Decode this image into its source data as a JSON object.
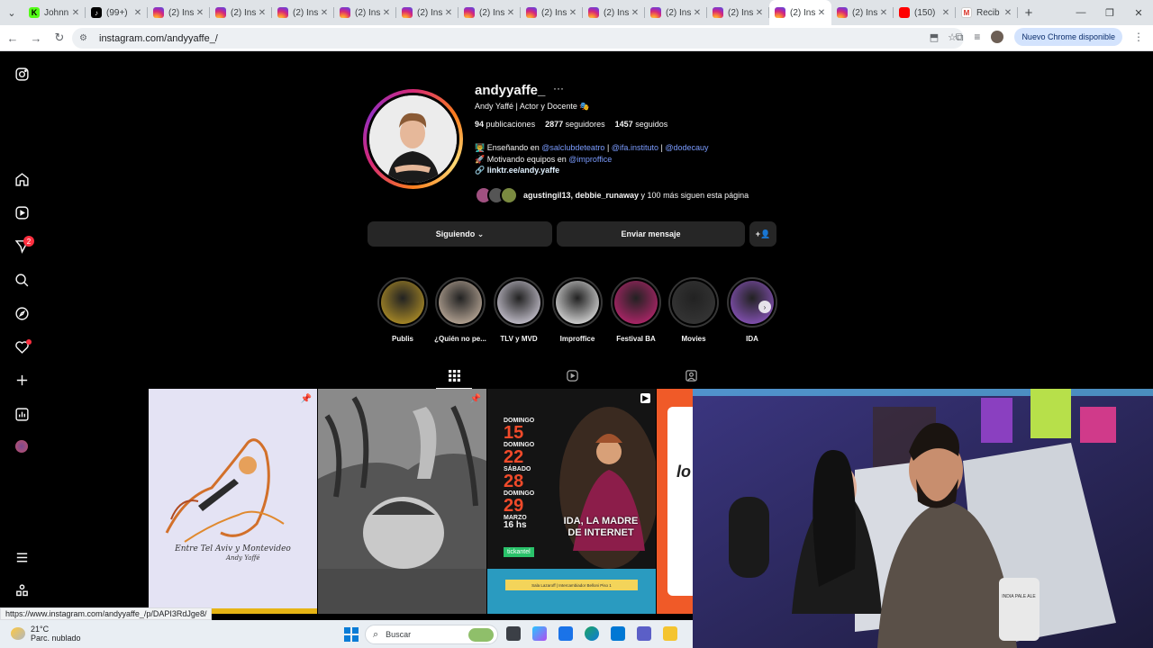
{
  "browser": {
    "tabs": [
      {
        "label": "Johnn",
        "favicon": "kick-icon",
        "active": false
      },
      {
        "label": "(99+)",
        "favicon": "tiktok-icon",
        "active": false
      },
      {
        "label": "(2) Ins",
        "favicon": "instagram-icon",
        "active": false
      },
      {
        "label": "(2) Ins",
        "favicon": "instagram-icon",
        "active": false
      },
      {
        "label": "(2) Ins",
        "favicon": "instagram-icon",
        "active": false
      },
      {
        "label": "(2) Ins",
        "favicon": "instagram-icon",
        "active": false
      },
      {
        "label": "(2) Ins",
        "favicon": "instagram-icon",
        "active": false
      },
      {
        "label": "(2) Ins",
        "favicon": "instagram-icon",
        "active": false
      },
      {
        "label": "(2) Ins",
        "favicon": "instagram-icon",
        "active": false
      },
      {
        "label": "(2) Ins",
        "favicon": "instagram-icon",
        "active": false
      },
      {
        "label": "(2) Ins",
        "favicon": "instagram-icon",
        "active": false
      },
      {
        "label": "(2) Ins",
        "favicon": "instagram-icon",
        "active": false
      },
      {
        "label": "(2) Ins",
        "favicon": "instagram-icon",
        "active": true
      },
      {
        "label": "(2) Ins",
        "favicon": "instagram-icon",
        "active": false
      },
      {
        "label": "(150)",
        "favicon": "youtube-icon",
        "active": false
      },
      {
        "label": "Recib",
        "favicon": "gmail-icon",
        "active": false
      }
    ],
    "url": "instagram.com/andyyaffe_/",
    "update_label": "Nuevo Chrome disponible",
    "status_url": "https://www.instagram.com/andyyaffe_/p/DAPI3RdJge8/"
  },
  "sidebar": {
    "notifications_badge": "2"
  },
  "profile": {
    "username": "andyyaffe_",
    "more": "···",
    "full_name": "Andy Yaffé | Actor y Docente 🎭",
    "stats": {
      "posts_count": "94",
      "posts_label": "publicaciones",
      "followers_count": "2877",
      "followers_label": "seguidores",
      "following_count": "1457",
      "following_label": "seguidos"
    },
    "bio": {
      "line1_prefix": "👨‍🏫 Enseñando en ",
      "line1_link1": "@salclubdeteatro",
      "line1_sep1": " | ",
      "line1_link2": "@ifa.instituto",
      "line1_sep2": " | ",
      "line1_link3": "@dodecauy",
      "line2_prefix": "🚀 Motivando equipos en ",
      "line2_link": "@improffice",
      "line3_link": "🔗 linktr.ee/andy.yaffe"
    },
    "followed_by": {
      "names": "agustingil13, debbie_runaway",
      "rest": " y 100 más siguen esta página"
    },
    "buttons": {
      "following": "Siguiendo ⌄",
      "message": "Enviar mensaje",
      "suggest": "+👤"
    }
  },
  "highlights": [
    {
      "label": "Publis",
      "color": "#c9a227"
    },
    {
      "label": "¿Quién no pe...",
      "color": "#d9c4b0"
    },
    {
      "label": "TLV y MVD",
      "color": "#e9e4f3"
    },
    {
      "label": "Improffice",
      "color": "#ffffff"
    },
    {
      "label": "Festival BA",
      "color": "#d0267a"
    },
    {
      "label": "Movies",
      "color": "#3a3a3a"
    },
    {
      "label": "IDA",
      "color": "#9b5cd6"
    }
  ],
  "posts": [
    {
      "caption": "Entre Tel Aviv y Montevideo",
      "author": "Andy Yaffé"
    },
    {
      "caption": "",
      "author": ""
    },
    {
      "dates": [
        "DOMINGO",
        "15",
        "DOMINGO",
        "22",
        "SÁBADO",
        "28",
        "DOMINGO",
        "29",
        "MARZO",
        "16 hs"
      ],
      "ticket": "tickantel",
      "title": "IDA, LA MADRE DE INTERNET",
      "venue": "Sala Lazaroff | Intercambiador Belloni Piso 1"
    }
  ],
  "webcam": {
    "tshirt_text": "INDIA PALE ALE"
  },
  "taskbar": {
    "temperature": "21°C",
    "weather": "Parc. nublado",
    "search_placeholder": "Buscar"
  }
}
